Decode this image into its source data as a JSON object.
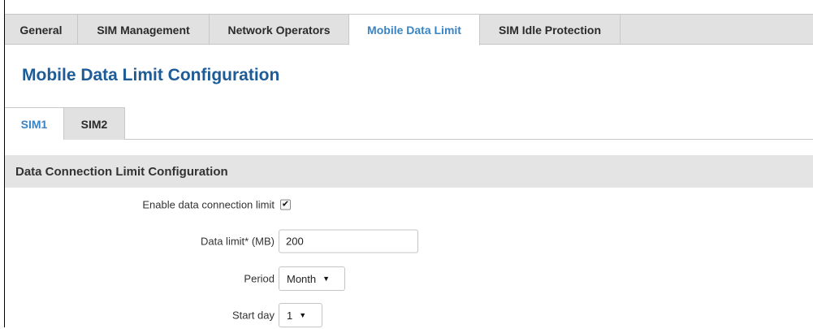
{
  "top_tabs": [
    {
      "label": "General",
      "active": false
    },
    {
      "label": "SIM Management",
      "active": false
    },
    {
      "label": "Network Operators",
      "active": false
    },
    {
      "label": "Mobile Data Limit",
      "active": true
    },
    {
      "label": "SIM Idle Protection",
      "active": false
    }
  ],
  "page_title": "Mobile Data Limit Configuration",
  "sim_tabs": [
    {
      "label": "SIM1",
      "active": true
    },
    {
      "label": "SIM2",
      "active": false
    }
  ],
  "section": {
    "title": "Data Connection Limit Configuration"
  },
  "form": {
    "enable_limit": {
      "label": "Enable data connection limit",
      "checked": true,
      "check_glyph": "✔"
    },
    "data_limit": {
      "label": "Data limit* (MB)",
      "value": "200"
    },
    "period": {
      "label": "Period",
      "value": "Month"
    },
    "start_day": {
      "label": "Start day",
      "value": "1"
    }
  },
  "colors": {
    "accent": "#3a84c4",
    "title": "#1e5c98",
    "tab_bg": "#e1e1e1",
    "section_bg": "#e4e4e4"
  }
}
